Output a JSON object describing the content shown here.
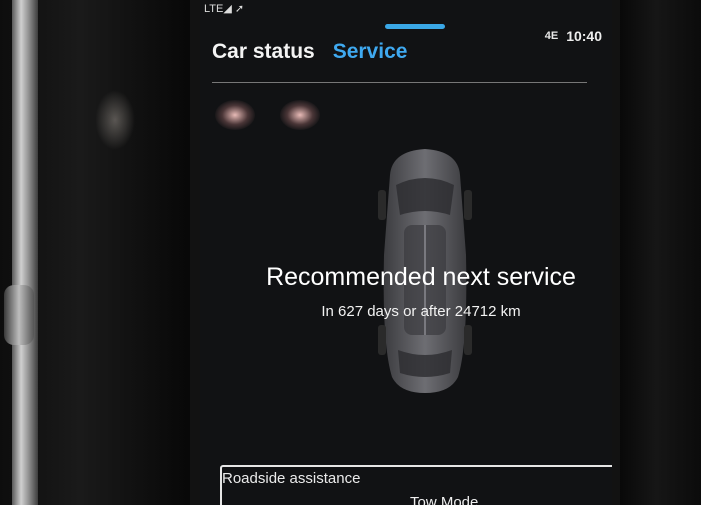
{
  "status_bar": {
    "left_indicators": "LTE◢ ➚",
    "connectivity": "4E",
    "time": "10:40"
  },
  "tabs": [
    {
      "label": "Car status",
      "active": false
    },
    {
      "label": "Service",
      "active": true
    }
  ],
  "service": {
    "title": "Recommended next service",
    "detail": "In 627 days or after 24712 km"
  },
  "bottom": {
    "roadside_label": "Roadside assistance",
    "tow_mode_label": "Tow Mode"
  },
  "colors": {
    "accent": "#3fa9f0",
    "screen_bg": "#111214",
    "text": "#ffffff"
  }
}
